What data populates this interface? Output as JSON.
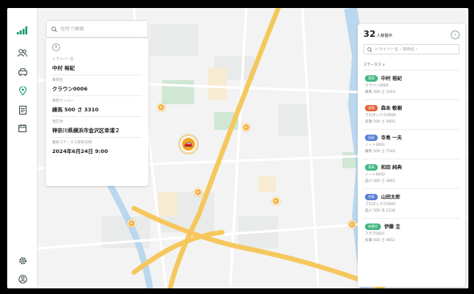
{
  "icons": {
    "signal": "signal-icon",
    "users": "users-icon",
    "car": "car-icon",
    "location": "location-icon",
    "report": "report-icon",
    "calendar": "calendar-icon",
    "settings": "gear-icon",
    "account": "account-icon"
  },
  "colors": {
    "accent": "#1d9e73",
    "marker": "#f0a322",
    "badge_green": "#41b883",
    "badge_red": "#e0673f",
    "badge_blue": "#5a7fd8"
  },
  "search": {
    "placeholder": "住所で検索"
  },
  "detail": {
    "fields": [
      {
        "label": "ドライバー名",
        "value": "中村 裕紀"
      },
      {
        "label": "車両名",
        "value": "クラウン0006"
      },
      {
        "label": "車両ナンバー",
        "value": "練馬 500 さ 3310"
      },
      {
        "label": "現在地",
        "value": "神奈川県横浜市金沢区幸浦２"
      },
      {
        "label": "最終ステータス更新日時",
        "value": "2024年6月24日 9:00"
      }
    ]
  },
  "panel": {
    "count": "32",
    "count_unit": "人稼働中",
    "search_placeholder": "ドライバー名・車両名・",
    "filter_label": "ステータス ∨",
    "drivers": [
      {
        "status": "実車",
        "name": "中村 裕紀",
        "vehicle": "クラウン0006",
        "plate": "練馬 500 さ 3310"
      },
      {
        "status": "迎車",
        "name": "森本 敏樹",
        "vehicle": "プロボックス0009",
        "plate": "多摩 500 さ 0001"
      },
      {
        "status": "回送",
        "name": "寺島 一夫",
        "vehicle": "ノート0001",
        "plate": "練馬 500 さ 7541"
      },
      {
        "status": "実車",
        "name": "和田 純典",
        "vehicle": "ノート0002",
        "plate": "品川 500 さ 3661"
      },
      {
        "status": "空車",
        "name": "山田太郎",
        "vehicle": "プロボックス0001",
        "plate": "品川 500 あ 1234"
      },
      {
        "status": "休憩中",
        "name": "伊藤 圭",
        "vehicle": "アクア0007",
        "plate": "多摩 500 さ 0651"
      }
    ]
  }
}
